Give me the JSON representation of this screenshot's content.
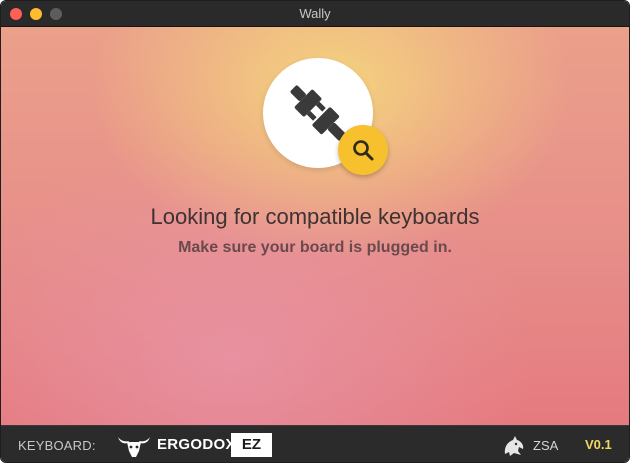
{
  "window": {
    "title": "Wally"
  },
  "main": {
    "heading": "Looking for compatible keyboards",
    "subheading": "Make sure your board is plugged in.",
    "icons": {
      "plug": "plug-icon",
      "search": "search-icon"
    }
  },
  "footer": {
    "keyboard_label": "KEYBOARD:",
    "brand_name": "ERGODOX",
    "brand_suffix": "EZ",
    "company": "ZSA",
    "version": "V0.1"
  },
  "colors": {
    "badge": "#f6c12c",
    "version": "#f2d664",
    "footer_bg": "#2b2b2b",
    "heading": "#3f3233"
  }
}
